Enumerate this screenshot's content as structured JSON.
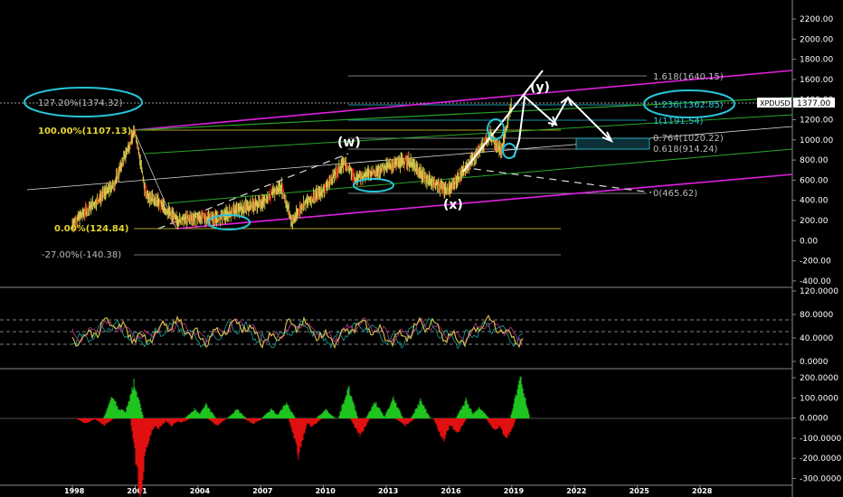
{
  "symbol": "XPDUSD",
  "price_tag": "1377.00",
  "colors": {
    "background": "#000000",
    "candle": "#d4c44a",
    "channel": "#e020e0",
    "green_line": "#2aa52a",
    "annotation": "#26c6da",
    "fib_white": "#bbbbbb",
    "fib_yellow": "#e7d533",
    "hist_up": "#1fc41f",
    "hist_down": "#e01010"
  },
  "price_axis": [
    "2200.00",
    "2000.00",
    "1800.00",
    "1600.00",
    "1400.00",
    "1200.00",
    "1000.00",
    "800.00",
    "600.00",
    "400.00",
    "200.00",
    "0.00",
    "-200.00",
    "-400.00"
  ],
  "rsi_axis": [
    "120.0000",
    "80.0000",
    "40.0000",
    "0.0000"
  ],
  "macd_axis": [
    "200.0000",
    "100.0000",
    "0.0000",
    "-100.0000",
    "-200.0000",
    "-300.0000"
  ],
  "date_axis": [
    "1998",
    "2001",
    "2004",
    "2007",
    "2010",
    "2013",
    "2016",
    "2019",
    "2022",
    "2025",
    "2028"
  ],
  "fib_labels": {
    "ext_127": "127.20%(1374.32)",
    "f100": "100.00%(1107.13)",
    "f0": "0.00%(124.84)",
    "fneg27": "-27.00%(-140.38)",
    "t1618": "1.618(1640.15)",
    "t1236": "1.236(1362.85)",
    "t1": "1(1191.54)",
    "t0764": "0.764(1020.22)",
    "t0618": "0.618(914.24)",
    "t0": "0(465.62)"
  },
  "waves": {
    "w": "(w)",
    "x": "(x)",
    "y": "(y)"
  },
  "chart_data": {
    "type": "line",
    "series": [
      {
        "values": [
          [
            1998,
            170
          ],
          [
            1999,
            360
          ],
          [
            2000,
            560
          ],
          [
            2001,
            1100
          ],
          [
            2001.5,
            470
          ],
          [
            2002,
            400
          ],
          [
            2003,
            200
          ],
          [
            2004,
            230
          ],
          [
            2005,
            220
          ],
          [
            2006,
            320
          ],
          [
            2007,
            370
          ],
          [
            2008,
            540
          ],
          [
            2008.5,
            180
          ],
          [
            2009,
            350
          ],
          [
            2010,
            500
          ],
          [
            2011,
            780
          ],
          [
            2011.5,
            620
          ],
          [
            2012,
            650
          ],
          [
            2013,
            730
          ],
          [
            2014,
            800
          ],
          [
            2015,
            600
          ],
          [
            2016,
            500
          ],
          [
            2017,
            770
          ],
          [
            2018,
            1050
          ],
          [
            2018.5,
            880
          ],
          [
            2019,
            1377
          ]
        ]
      }
    ],
    "xlim": [
      1998,
      2030
    ],
    "ylim": [
      -400,
      2200
    ]
  }
}
